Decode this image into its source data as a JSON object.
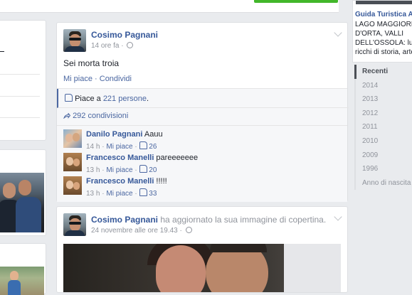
{
  "post1": {
    "author": "Cosimo Pagnani",
    "time": "14 ore fa · ",
    "text": "Sei morta troia",
    "like_link": "Mi piace",
    "sep": " · ",
    "share_link": "Condividi",
    "likes_prefix": "Piace a ",
    "likes_count": "221 persone",
    "likes_suffix": ".",
    "shares": "292 condivisioni",
    "comments": [
      {
        "name": "Danilo Pagnani",
        "text": " Aauu",
        "time": "14 h · ",
        "like": "Mi piace",
        "dot": " · ",
        "count": "26"
      },
      {
        "name": "Francesco Manelli",
        "text": " pareeeeeee",
        "time": "13 h · ",
        "like": "Mi piace",
        "dot": " · ",
        "count": "20"
      },
      {
        "name": "Francesco Manelli",
        "text": " !!!!!",
        "time": "13 h · ",
        "like": "Mi piace",
        "dot": " · ",
        "count": "33"
      }
    ]
  },
  "post2": {
    "author": "Cosimo Pagnani",
    "action": " ha aggiornato la sua immagine di copertina.",
    "time": "24 novembre alle ore 19.43 · "
  },
  "sidebar": {
    "page_title": "Guida Turistica Alto",
    "desc_lines": [
      "LAGO MAGGIORE,",
      "D'ORTA, VALLI",
      "DELL'OSSOLA: luog",
      "ricchi di storia, arte, t"
    ]
  },
  "timeline": {
    "years": [
      "Recenti",
      "2014",
      "2013",
      "2012",
      "2011",
      "2010",
      "2009",
      "1996",
      "Anno di nascita"
    ]
  },
  "icons": {
    "privacy": "globe-icon",
    "like": "thumbs-up-icon",
    "share": "share-arrow-icon",
    "menu": "chevron-down-icon"
  },
  "colors": {
    "link": "#365899",
    "background": "#e9ebee",
    "accent_green": "#42b72a"
  }
}
